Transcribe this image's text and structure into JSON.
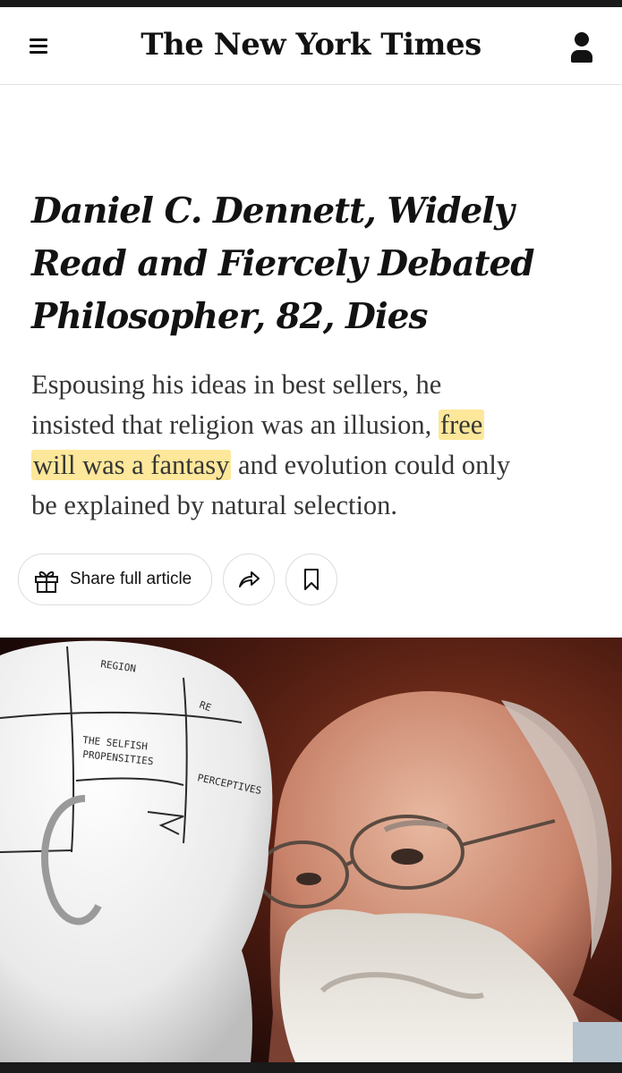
{
  "masthead": {
    "logo_text": "The New York Times",
    "menu_icon": "hamburger-menu-icon",
    "account_icon": "person-icon"
  },
  "article": {
    "headline_lines": [
      "Daniel C. Dennett, Widely",
      "Read and Fiercely Debated",
      "Philosopher, 82, Dies"
    ],
    "summary_lines": [
      "Espousing his ideas in best sellers, he",
      "insisted that religion was an illusion,",
      "free",
      "will was a fantasy",
      "and evolution could only",
      "be explained by natural selection."
    ],
    "highlight_color": "#fde79a"
  },
  "actions": {
    "share_label": "Share full article",
    "share_icon": "gift-icon",
    "forward_icon": "share-arrow-icon",
    "bookmark_icon": "bookmark-icon"
  },
  "photo": {
    "bust_labels": [
      "REGION",
      "THE SELFISH",
      "PROPENSITIES",
      "PERCEPTIVES",
      "RE"
    ]
  }
}
